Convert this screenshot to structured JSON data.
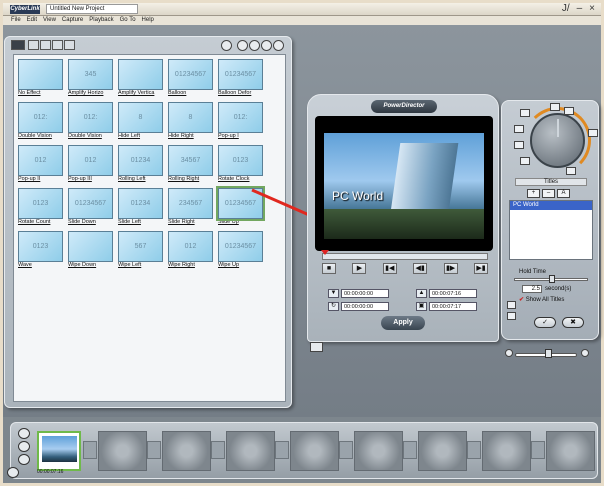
{
  "app": {
    "logo_text": "CyberLink",
    "project_title": "Untitled New Project",
    "window_buttons": [
      "J/",
      "–",
      "×"
    ]
  },
  "menu": [
    "File",
    "Edit",
    "View",
    "Capture",
    "Playback",
    "Go To",
    "Help"
  ],
  "effects": [
    {
      "label": "No Effect",
      "thumb": ""
    },
    {
      "label": "Amplify Horizo",
      "thumb": "345"
    },
    {
      "label": "Amplify Vertica",
      "thumb": ""
    },
    {
      "label": "Balloon",
      "thumb": "01234567"
    },
    {
      "label": "Balloon Defor",
      "thumb": "01234567"
    },
    {
      "label": "Double Vision",
      "thumb": "012:"
    },
    {
      "label": "Double Vision",
      "thumb": "012:"
    },
    {
      "label": "Hide Left",
      "thumb": "8"
    },
    {
      "label": "Hide Right",
      "thumb": "8"
    },
    {
      "label": "Pop-up I",
      "thumb": "012:"
    },
    {
      "label": "Pop-up II",
      "thumb": "012"
    },
    {
      "label": "Pop-up III",
      "thumb": "012"
    },
    {
      "label": "Rolling Left",
      "thumb": "01234"
    },
    {
      "label": "Rolling Right",
      "thumb": "34567"
    },
    {
      "label": "Rotate Clock",
      "thumb": "0123"
    },
    {
      "label": "Rotate Count",
      "thumb": "0123"
    },
    {
      "label": "Slide Down",
      "thumb": "01234567"
    },
    {
      "label": "Slide Left",
      "thumb": "01234"
    },
    {
      "label": "Slide Right",
      "thumb": "234567"
    },
    {
      "label": "Slide Up",
      "thumb": "01234567"
    },
    {
      "label": "Wave",
      "thumb": "0123"
    },
    {
      "label": "Wipe Down",
      "thumb": ""
    },
    {
      "label": "Wipe Left",
      "thumb": "567"
    },
    {
      "label": "Wipe Right",
      "thumb": "012"
    },
    {
      "label": "Wipe Up",
      "thumb": "01234567"
    }
  ],
  "preview": {
    "badge": "PowerDirector",
    "caption": "PC World",
    "controls": [
      "■",
      "▶",
      "▮◀",
      "◀▮",
      "▮▶",
      "▶▮"
    ],
    "timecodes": {
      "current": "00:00:00:00",
      "duration": "00:00:00:00",
      "mark_in": "00:00:07:16",
      "mark_out": "00:00:07:17"
    },
    "apply_label": "Apply"
  },
  "titles_panel": {
    "header": "Titles",
    "buttons": [
      "+",
      "–",
      "A"
    ],
    "items": [
      "PC World"
    ],
    "hold_label": "Hold Time",
    "hold_value": "2.5",
    "hold_unit": "second(s)",
    "show_all_label": "Show All Titles",
    "ok_icon": "✓",
    "cancel_icon": "✖"
  },
  "timeline": {
    "first_clip_time": "00:00:07:16",
    "slot_count": 8
  },
  "colors": {
    "accent_arrow": "#e0281f",
    "selection": "#3a64c8",
    "thumb_fill": "#8fcde9"
  }
}
